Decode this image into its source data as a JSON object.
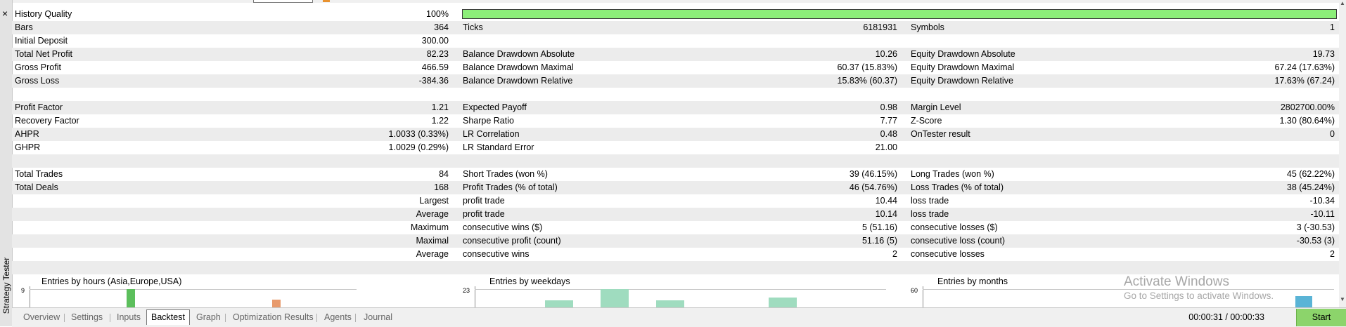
{
  "panel": {
    "title": "Strategy Tester",
    "close_glyph": "×"
  },
  "history_quality": {
    "label": "History Quality",
    "value": "100%",
    "fraction": 1.0
  },
  "rows": [
    {
      "l1": "Bars",
      "v1": "364",
      "l2": "Ticks",
      "v2": "6181931",
      "l3": "Symbols",
      "v3": "1"
    },
    {
      "l1": "Initial Deposit",
      "v1": "300.00",
      "l2": "",
      "v2": "",
      "l3": "",
      "v3": ""
    },
    {
      "l1": "Total Net Profit",
      "v1": "82.23",
      "l2": "Balance Drawdown Absolute",
      "v2": "10.26",
      "l3": "Equity Drawdown Absolute",
      "v3": "19.73"
    },
    {
      "l1": "Gross Profit",
      "v1": "466.59",
      "l2": "Balance Drawdown Maximal",
      "v2": "60.37 (15.83%)",
      "l3": "Equity Drawdown Maximal",
      "v3": "67.24 (17.63%)"
    },
    {
      "l1": "Gross Loss",
      "v1": "-384.36",
      "l2": "Balance Drawdown Relative",
      "v2": "15.83% (60.37)",
      "l3": "Equity Drawdown Relative",
      "v3": "17.63% (67.24)"
    },
    {
      "l1": "",
      "v1": "",
      "l2": "",
      "v2": "",
      "l3": "",
      "v3": ""
    },
    {
      "l1": "Profit Factor",
      "v1": "1.21",
      "l2": "Expected Payoff",
      "v2": "0.98",
      "l3": "Margin Level",
      "v3": "2802700.00%"
    },
    {
      "l1": "Recovery Factor",
      "v1": "1.22",
      "l2": "Sharpe Ratio",
      "v2": "7.77",
      "l3": "Z-Score",
      "v3": "1.30 (80.64%)"
    },
    {
      "l1": "AHPR",
      "v1": "1.0033 (0.33%)",
      "l2": "LR Correlation",
      "v2": "0.48",
      "l3": "OnTester result",
      "v3": "0"
    },
    {
      "l1": "GHPR",
      "v1": "1.0029 (0.29%)",
      "l2": "LR Standard Error",
      "v2": "21.00",
      "l3": "",
      "v3": ""
    },
    {
      "l1": "",
      "v1": "",
      "l2": "",
      "v2": "",
      "l3": "",
      "v3": ""
    },
    {
      "l1": "Total Trades",
      "v1": "84",
      "l2": "Short Trades (won %)",
      "v2": "39 (46.15%)",
      "l3": "Long Trades (won %)",
      "v3": "45 (62.22%)"
    },
    {
      "l1": "Total Deals",
      "v1": "168",
      "l2": "Profit Trades (% of total)",
      "v2": "46 (54.76%)",
      "l3": "Loss Trades (% of total)",
      "v3": "38 (45.24%)"
    },
    {
      "l1": "",
      "v1": "Largest",
      "l2": "profit trade",
      "v2": "10.44",
      "l3": "loss trade",
      "v3": "-10.34"
    },
    {
      "l1": "",
      "v1": "Average",
      "l2": "profit trade",
      "v2": "10.14",
      "l3": "loss trade",
      "v3": "-10.11"
    },
    {
      "l1": "",
      "v1": "Maximum",
      "l2": "consecutive wins ($)",
      "v2": "5 (51.16)",
      "l3": "consecutive losses ($)",
      "v3": "3 (-30.53)"
    },
    {
      "l1": "",
      "v1": "Maximal",
      "l2": "consecutive profit (count)",
      "v2": "51.16 (5)",
      "l3": "consecutive loss (count)",
      "v3": "-30.53 (3)"
    },
    {
      "l1": "",
      "v1": "Average",
      "l2": "consecutive wins",
      "v2": "2",
      "l3": "consecutive losses",
      "v3": "2"
    },
    {
      "l1": "",
      "v1": "",
      "l2": "",
      "v2": "",
      "l3": "",
      "v3": ""
    }
  ],
  "charts": [
    {
      "title": "Entries by hours (Asia,Europe,USA)",
      "ytick": "9"
    },
    {
      "title": "Entries by weekdays",
      "ytick": "23"
    },
    {
      "title": "Entries by months",
      "ytick": "60"
    }
  ],
  "watermark": {
    "line1": "Activate Windows",
    "line2": "Go to Settings to activate Windows."
  },
  "tabs": [
    "Overview",
    "Settings",
    "Inputs",
    "Backtest",
    "Graph",
    "Optimization Results",
    "Agents",
    "Journal"
  ],
  "active_tab": "Backtest",
  "status": {
    "time": "00:00:31 / 00:00:33",
    "start_label": "Start"
  },
  "colors": {
    "quality_bar": "#8cee79",
    "start_button": "#8cd46b",
    "bar_green": "#5cbf5c",
    "bar_orange": "#e89a6c",
    "bar_teal": "#9fdcbf",
    "bar_blue": "#5ab4d6"
  }
}
